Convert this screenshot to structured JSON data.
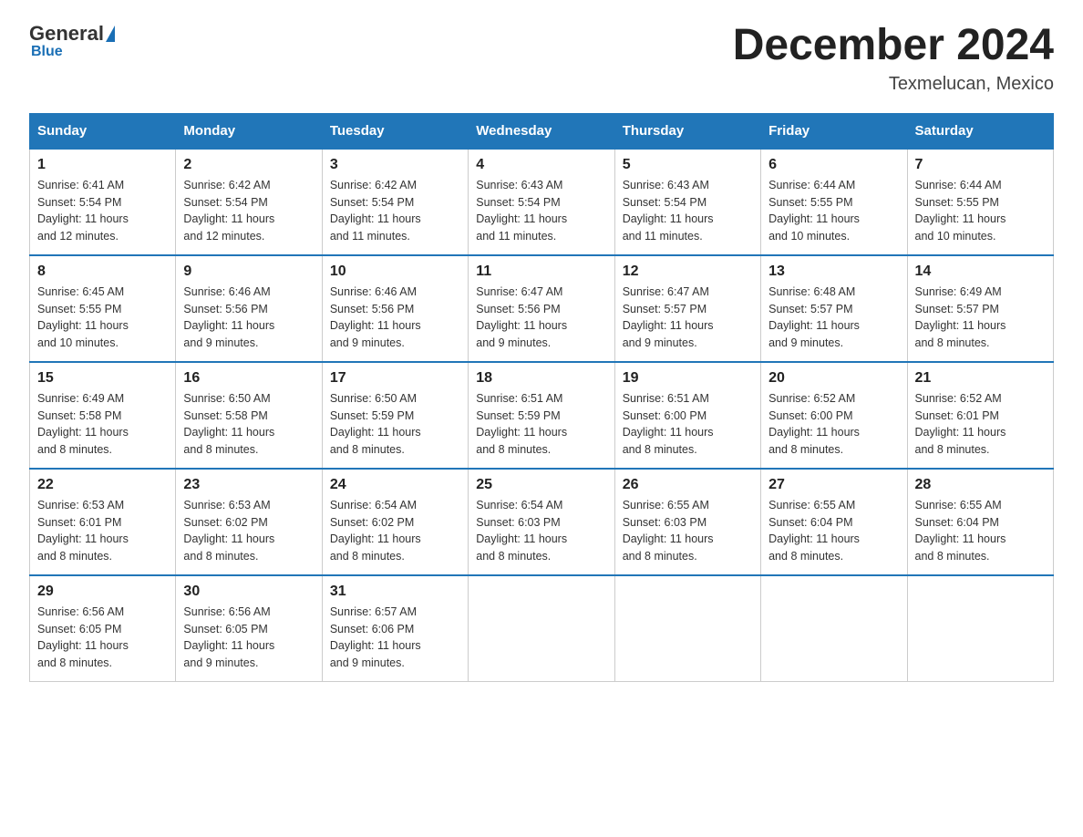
{
  "header": {
    "logo_general": "General",
    "logo_blue": "Blue",
    "month_title": "December 2024",
    "location": "Texmelucan, Mexico"
  },
  "weekdays": [
    "Sunday",
    "Monday",
    "Tuesday",
    "Wednesday",
    "Thursday",
    "Friday",
    "Saturday"
  ],
  "weeks": [
    [
      {
        "day": "1",
        "sunrise": "6:41 AM",
        "sunset": "5:54 PM",
        "daylight": "11 hours and 12 minutes."
      },
      {
        "day": "2",
        "sunrise": "6:42 AM",
        "sunset": "5:54 PM",
        "daylight": "11 hours and 12 minutes."
      },
      {
        "day": "3",
        "sunrise": "6:42 AM",
        "sunset": "5:54 PM",
        "daylight": "11 hours and 11 minutes."
      },
      {
        "day": "4",
        "sunrise": "6:43 AM",
        "sunset": "5:54 PM",
        "daylight": "11 hours and 11 minutes."
      },
      {
        "day": "5",
        "sunrise": "6:43 AM",
        "sunset": "5:54 PM",
        "daylight": "11 hours and 11 minutes."
      },
      {
        "day": "6",
        "sunrise": "6:44 AM",
        "sunset": "5:55 PM",
        "daylight": "11 hours and 10 minutes."
      },
      {
        "day": "7",
        "sunrise": "6:44 AM",
        "sunset": "5:55 PM",
        "daylight": "11 hours and 10 minutes."
      }
    ],
    [
      {
        "day": "8",
        "sunrise": "6:45 AM",
        "sunset": "5:55 PM",
        "daylight": "11 hours and 10 minutes."
      },
      {
        "day": "9",
        "sunrise": "6:46 AM",
        "sunset": "5:56 PM",
        "daylight": "11 hours and 9 minutes."
      },
      {
        "day": "10",
        "sunrise": "6:46 AM",
        "sunset": "5:56 PM",
        "daylight": "11 hours and 9 minutes."
      },
      {
        "day": "11",
        "sunrise": "6:47 AM",
        "sunset": "5:56 PM",
        "daylight": "11 hours and 9 minutes."
      },
      {
        "day": "12",
        "sunrise": "6:47 AM",
        "sunset": "5:57 PM",
        "daylight": "11 hours and 9 minutes."
      },
      {
        "day": "13",
        "sunrise": "6:48 AM",
        "sunset": "5:57 PM",
        "daylight": "11 hours and 9 minutes."
      },
      {
        "day": "14",
        "sunrise": "6:49 AM",
        "sunset": "5:57 PM",
        "daylight": "11 hours and 8 minutes."
      }
    ],
    [
      {
        "day": "15",
        "sunrise": "6:49 AM",
        "sunset": "5:58 PM",
        "daylight": "11 hours and 8 minutes."
      },
      {
        "day": "16",
        "sunrise": "6:50 AM",
        "sunset": "5:58 PM",
        "daylight": "11 hours and 8 minutes."
      },
      {
        "day": "17",
        "sunrise": "6:50 AM",
        "sunset": "5:59 PM",
        "daylight": "11 hours and 8 minutes."
      },
      {
        "day": "18",
        "sunrise": "6:51 AM",
        "sunset": "5:59 PM",
        "daylight": "11 hours and 8 minutes."
      },
      {
        "day": "19",
        "sunrise": "6:51 AM",
        "sunset": "6:00 PM",
        "daylight": "11 hours and 8 minutes."
      },
      {
        "day": "20",
        "sunrise": "6:52 AM",
        "sunset": "6:00 PM",
        "daylight": "11 hours and 8 minutes."
      },
      {
        "day": "21",
        "sunrise": "6:52 AM",
        "sunset": "6:01 PM",
        "daylight": "11 hours and 8 minutes."
      }
    ],
    [
      {
        "day": "22",
        "sunrise": "6:53 AM",
        "sunset": "6:01 PM",
        "daylight": "11 hours and 8 minutes."
      },
      {
        "day": "23",
        "sunrise": "6:53 AM",
        "sunset": "6:02 PM",
        "daylight": "11 hours and 8 minutes."
      },
      {
        "day": "24",
        "sunrise": "6:54 AM",
        "sunset": "6:02 PM",
        "daylight": "11 hours and 8 minutes."
      },
      {
        "day": "25",
        "sunrise": "6:54 AM",
        "sunset": "6:03 PM",
        "daylight": "11 hours and 8 minutes."
      },
      {
        "day": "26",
        "sunrise": "6:55 AM",
        "sunset": "6:03 PM",
        "daylight": "11 hours and 8 minutes."
      },
      {
        "day": "27",
        "sunrise": "6:55 AM",
        "sunset": "6:04 PM",
        "daylight": "11 hours and 8 minutes."
      },
      {
        "day": "28",
        "sunrise": "6:55 AM",
        "sunset": "6:04 PM",
        "daylight": "11 hours and 8 minutes."
      }
    ],
    [
      {
        "day": "29",
        "sunrise": "6:56 AM",
        "sunset": "6:05 PM",
        "daylight": "11 hours and 8 minutes."
      },
      {
        "day": "30",
        "sunrise": "6:56 AM",
        "sunset": "6:05 PM",
        "daylight": "11 hours and 9 minutes."
      },
      {
        "day": "31",
        "sunrise": "6:57 AM",
        "sunset": "6:06 PM",
        "daylight": "11 hours and 9 minutes."
      },
      null,
      null,
      null,
      null
    ]
  ],
  "labels": {
    "sunrise": "Sunrise:",
    "sunset": "Sunset:",
    "daylight": "Daylight:"
  }
}
